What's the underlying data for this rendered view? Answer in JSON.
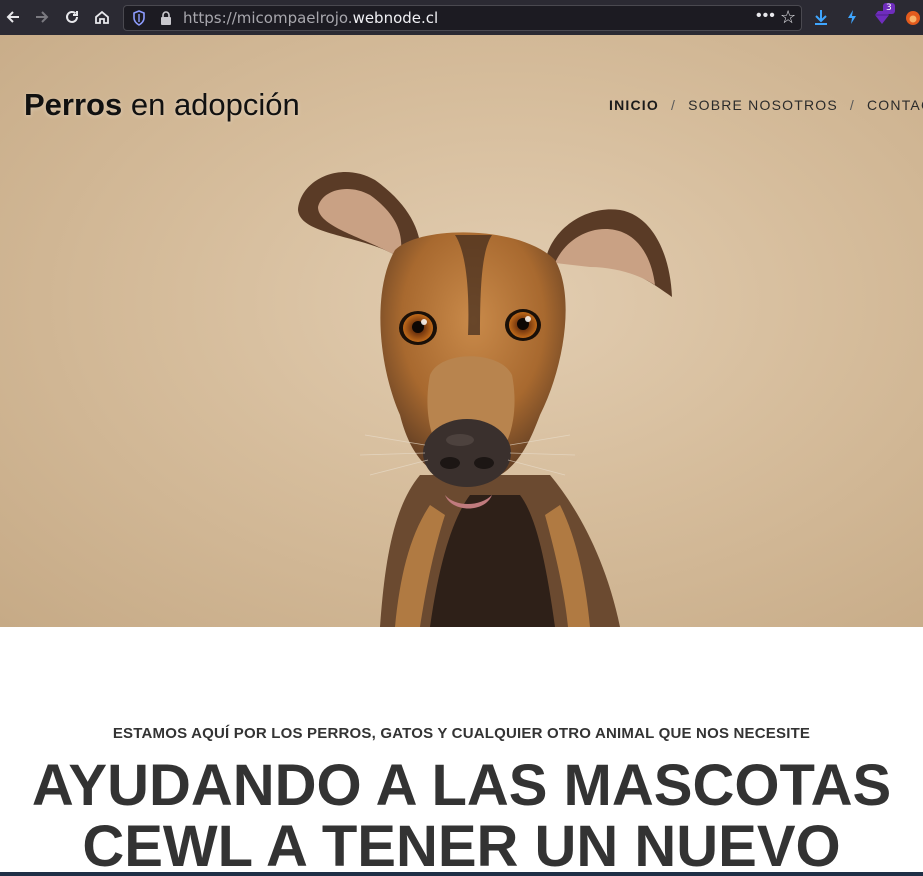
{
  "browser": {
    "url_prefix": "https://micompaelrojo.",
    "url_host": "webnode.cl",
    "extension_badge": "3",
    "accent_color": "#2b2a33"
  },
  "site": {
    "brand_bold": "Perros",
    "brand_rest": " en adopción",
    "nav": [
      {
        "label": "INICIO",
        "active": true
      },
      {
        "label": "SOBRE NOSOTROS",
        "active": false
      },
      {
        "label": "CONTACTO",
        "active": false
      }
    ],
    "nav_separator": "/"
  },
  "content": {
    "eyebrow": "ESTAMOS AQUÍ POR LOS PERROS, GATOS Y CUALQUIER OTRO ANIMAL QUE NOS NECESITE",
    "headline_line1": "AYUDANDO A LAS MASCOTAS",
    "headline_line2": "CEWL A TENER UN NUEVO"
  },
  "icons": [
    "back-icon",
    "forward-icon",
    "reload-icon",
    "home-icon",
    "tracking-shield-icon",
    "lock-icon",
    "page-actions-icon",
    "bookmark-star-icon",
    "download-icon",
    "extension-bolt-icon",
    "extension-gem-icon",
    "extension-fox-icon"
  ]
}
